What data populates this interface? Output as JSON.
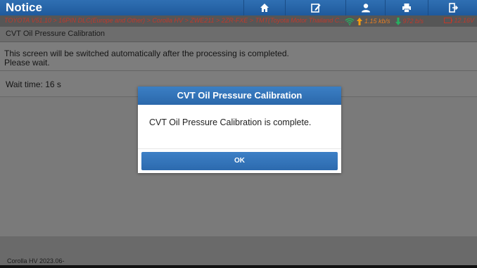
{
  "app": {
    "title": "Notice"
  },
  "toolbar": {
    "icons": [
      "home-icon",
      "edit-icon",
      "user-icon",
      "print-icon",
      "exit-icon"
    ]
  },
  "breadcrumb": {
    "path": "TOYOTA V51.10 > 16PIN DLC(Europe and Other) > Corolla HV > ZWE211 > 2ZR-FXE > TMT(Toyota Motor Thailand C...",
    "upload_speed": "1.15 kb/s",
    "download_speed": "972 b/s",
    "battery_voltage": "12.16V"
  },
  "page": {
    "header": "CVT Oil Pressure Calibration",
    "message_line1": "This screen will be switched automatically after the processing is completed.",
    "message_line2": "Please wait.",
    "wait_time": "Wait time: 16 s"
  },
  "dialog": {
    "title": "CVT Oil Pressure Calibration",
    "body": "CVT Oil Pressure Calibration is complete.",
    "ok_label": "OK"
  },
  "footer": {
    "vehicle": "Corolla HV 2023.06-"
  },
  "colors": {
    "accent": "#2b68ab",
    "breadcrumb_text": "#c0392b",
    "upload": "#f39c12",
    "download": "#27ae60"
  }
}
